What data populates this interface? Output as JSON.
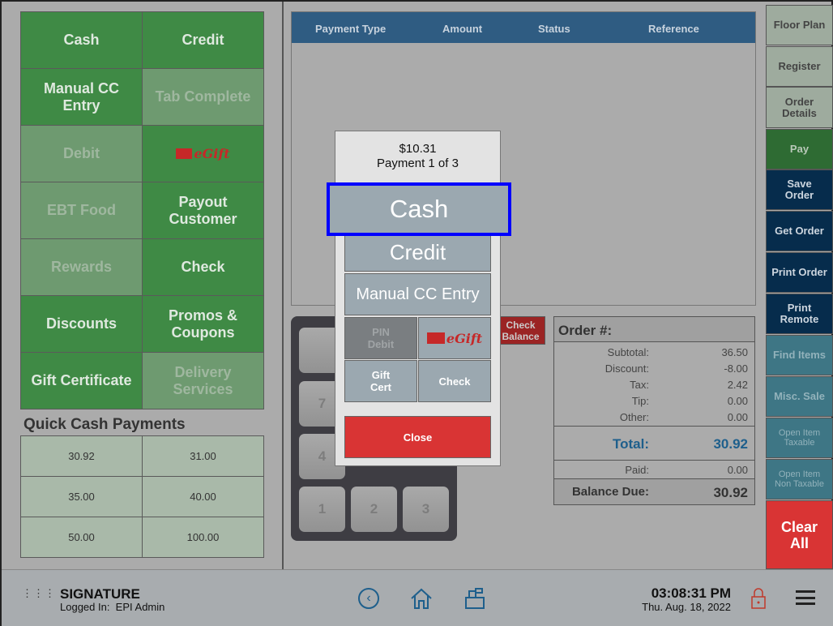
{
  "payment_buttons": [
    {
      "label": "Cash",
      "enabled": true
    },
    {
      "label": "Credit",
      "enabled": true
    },
    {
      "label": "Manual CC Entry",
      "enabled": true
    },
    {
      "label": "Tab Complete",
      "enabled": false
    },
    {
      "label": "Debit",
      "enabled": false
    },
    {
      "label": "eGift",
      "enabled": true,
      "icon": "gift-icon"
    },
    {
      "label": "EBT Food",
      "enabled": false
    },
    {
      "label": "Payout Customer",
      "enabled": true
    },
    {
      "label": "Rewards",
      "enabled": false
    },
    {
      "label": "Check",
      "enabled": true
    },
    {
      "label": "Discounts",
      "enabled": true
    },
    {
      "label": "Promos & Coupons",
      "enabled": true
    },
    {
      "label": "Gift Certificate",
      "enabled": true
    },
    {
      "label": "Delivery Services",
      "enabled": false
    }
  ],
  "quick_cash": {
    "title": "Quick Cash Payments",
    "amounts": [
      "30.92",
      "31.00",
      "35.00",
      "40.00",
      "50.00",
      "100.00"
    ]
  },
  "payments_table": {
    "headers": [
      "Payment Type",
      "Amount",
      "Status",
      "Reference"
    ]
  },
  "keypad": {
    "keys": [
      "7",
      "4",
      "1",
      "2",
      "3"
    ]
  },
  "check_balance": {
    "label": "Check Balance"
  },
  "order_summary": {
    "title": "Order #:",
    "rows": [
      {
        "label": "Subtotal:",
        "value": "36.50"
      },
      {
        "label": "Discount:",
        "value": "-8.00"
      },
      {
        "label": "Tax:",
        "value": "2.42"
      },
      {
        "label": "Tip:",
        "value": "0.00"
      },
      {
        "label": "Other:",
        "value": "0.00"
      }
    ],
    "total_label": "Total:",
    "total": "30.92",
    "paid_label": "Paid:",
    "paid": "0.00",
    "balance_label": "Balance Due:",
    "balance": "30.92"
  },
  "sidebar": [
    "Floor Plan",
    "Register",
    "Order Details",
    "Pay",
    "Save Order",
    "Get Order",
    "Print Order",
    "Print Remote",
    "Find Items",
    "Misc. Sale",
    "Open Item Taxable",
    "Open Item Non Taxable",
    "Clear All"
  ],
  "modal": {
    "amount": "$10.31",
    "payment_of": "Payment 1 of 3",
    "cash": "Cash",
    "credit": "Credit",
    "manual": "Manual CC Entry",
    "pin_debit": "PIN Debit",
    "egift": "eGift",
    "gift_cert": "Gift Cert",
    "check": "Check",
    "close": "Close"
  },
  "footer": {
    "title": "SIGNATURE",
    "logged_in": "Logged In:  EPI Admin",
    "time": "03:08:31 PM",
    "date": "Thu. Aug. 18, 2022"
  },
  "colors": {
    "green": "#3f8a45",
    "navy": "#062c4c",
    "teal": "#3e7685",
    "red": "#d93434",
    "highlight": "#0000ff",
    "total_blue": "#1e5f8c"
  }
}
